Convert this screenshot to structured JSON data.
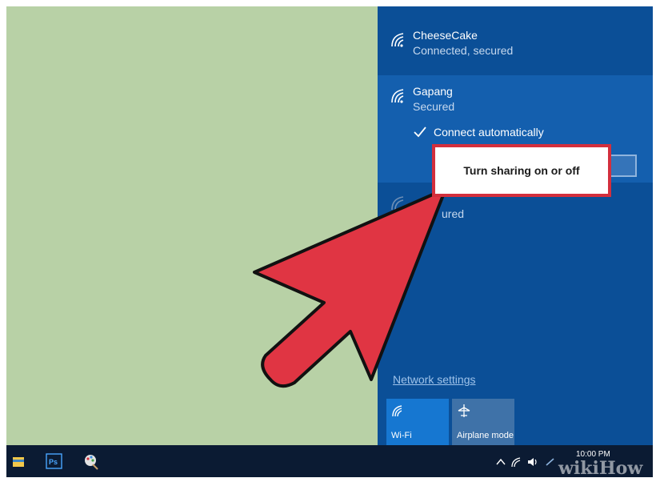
{
  "networks": [
    {
      "name": "CheeseCake",
      "status": "Connected, secured"
    },
    {
      "name": "Gapang",
      "status": "Secured",
      "auto_connect_label": "Connect automatically"
    },
    {
      "name": "",
      "status": "ured"
    }
  ],
  "tooltip": "Turn sharing on or off",
  "network_settings": "Network settings",
  "quick_actions": [
    {
      "label": "Wi-Fi",
      "icon": "wifi-icon"
    },
    {
      "label": "Airplane mode",
      "icon": "airplane-icon"
    }
  ],
  "taskbar": {
    "apps": [
      "file-explorer-icon",
      "photoshop-icon",
      "paint-icon"
    ],
    "tray": [
      "chevron-up-icon",
      "wifi-icon",
      "speaker-icon"
    ],
    "time": "10:00 PM"
  },
  "watermark": "wikiHow",
  "colors": {
    "desktop": "#b8d1a6",
    "panel": "#0b4f97",
    "selected_network": "#145fae",
    "tooltip_border": "#d32f3d",
    "arrow": "#e03543"
  }
}
